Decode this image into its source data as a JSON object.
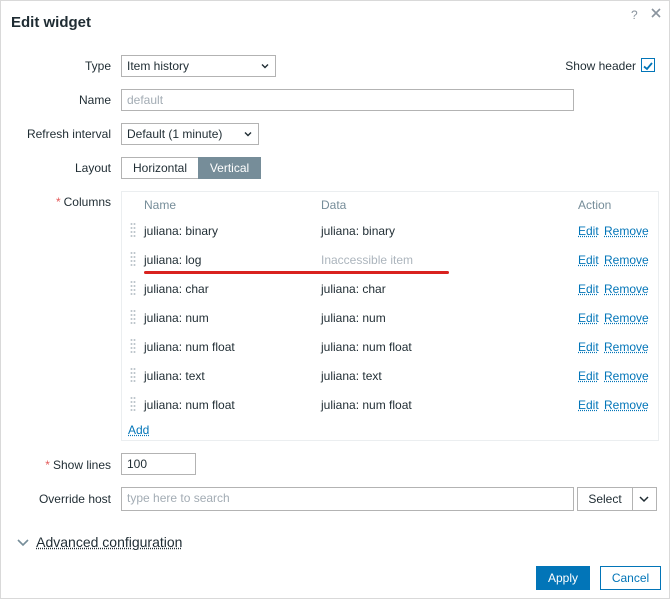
{
  "dialog": {
    "title": "Edit widget",
    "help": "?",
    "close": "close"
  },
  "form": {
    "type_label": "Type",
    "type_value": "Item history",
    "show_header_label": "Show header",
    "show_header_checked": true,
    "name_label": "Name",
    "name_placeholder": "default",
    "refresh_label": "Refresh interval",
    "refresh_value": "Default (1 minute)",
    "layout_label": "Layout",
    "layout_options": [
      "Horizontal",
      "Vertical"
    ],
    "layout_selected": "Vertical",
    "columns_label": "Columns",
    "show_lines_label": "Show lines",
    "show_lines_value": "100",
    "override_host_label": "Override host",
    "override_host_placeholder": "type here to search",
    "select_button": "Select"
  },
  "columns": {
    "headers": {
      "name": "Name",
      "data": "Data",
      "action": "Action"
    },
    "rows": [
      {
        "name": "juliana: binary",
        "data": "juliana: binary",
        "inaccessible": false
      },
      {
        "name": "juliana: log",
        "data": "Inaccessible item",
        "inaccessible": true
      },
      {
        "name": "juliana: char",
        "data": "juliana: char",
        "inaccessible": false
      },
      {
        "name": "juliana: num",
        "data": "juliana: num",
        "inaccessible": false
      },
      {
        "name": "juliana: num float",
        "data": "juliana: num float",
        "inaccessible": false
      },
      {
        "name": "juliana: text",
        "data": "juliana: text",
        "inaccessible": false
      },
      {
        "name": "juliana: num float",
        "data": "juliana: num float",
        "inaccessible": false
      }
    ],
    "edit_label": "Edit",
    "remove_label": "Remove",
    "add_label": "Add"
  },
  "advanced": {
    "label": "Advanced configuration"
  },
  "footer": {
    "apply": "Apply",
    "cancel": "Cancel"
  },
  "colors": {
    "accent": "#0275b8",
    "layout_active": "#768d99",
    "required": "#e45959",
    "highlight_line": "#d9221f"
  }
}
